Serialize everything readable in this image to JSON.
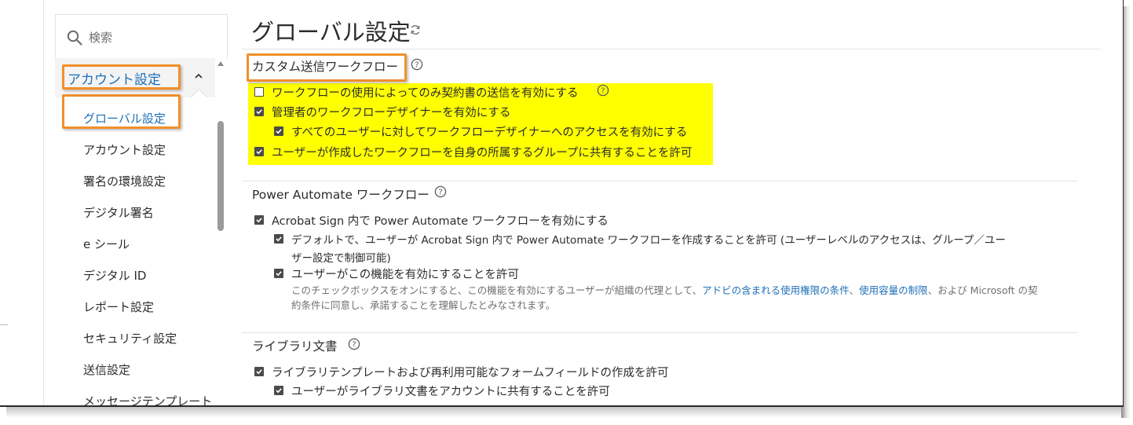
{
  "search": {
    "placeholder": "検索"
  },
  "nav": {
    "group_label": "アカウント設定",
    "items": [
      "グローバル設定",
      "アカウント設定",
      "署名の環境設定",
      "デジタル署名",
      "e シール",
      "デジタル ID",
      "レポート設定",
      "セキュリティ設定",
      "送信設定",
      "メッセージテンプレート"
    ],
    "active_index": 0
  },
  "page": {
    "title": "グローバル設定"
  },
  "sections": {
    "custom_workflow": {
      "title": "カスタム送信ワークフロー",
      "options": [
        {
          "label": "ワークフローの使用によってのみ契約書の送信を有効にする",
          "checked": false
        },
        {
          "label": "管理者のワークフローデザイナーを有効にする",
          "checked": true
        },
        {
          "label": "すべてのユーザーに対してワークフローデザイナーへのアクセスを有効にする",
          "checked": true
        },
        {
          "label": "ユーザーが作成したワークフローを自身の所属するグループに共有することを許可",
          "checked": true
        }
      ]
    },
    "power_automate": {
      "title": "Power Automate ワークフロー",
      "options": [
        {
          "label": "Acrobat Sign 内で Power Automate ワークフローを有効にする",
          "checked": true
        },
        {
          "label_line1": "デフォルトで、ユーザーが Acrobat Sign 内で Power Automate ワークフローを作成することを許可 (ユーザーレベルのアクセスは、グループ／ユー",
          "label_line2": "ザー設定で制御可能)",
          "checked": true
        },
        {
          "label": "ユーザーがこの機能を有効にすることを許可",
          "checked": true
        }
      ],
      "description": {
        "part1": "このチェックボックスをオンにすると、この機能を有効にするユーザーが組織の代理として、",
        "link1": "アドビの含まれる使用権限の条件",
        "sep": "、",
        "link2": "使用容量の制限",
        "part2": "、および Microsoft の契",
        "line2": "約条件に同意し、承諾することを理解したとみなされます。"
      }
    },
    "library": {
      "title": "ライブラリ文書",
      "options": [
        {
          "label": "ライブラリテンプレートおよび再利用可能なフォームフィールドの作成を許可",
          "checked": true
        },
        {
          "label": "ユーザーがライブラリ文書をアカウントに共有することを許可",
          "checked": true
        }
      ]
    }
  },
  "colors": {
    "accent_blue": "#1d6fb8",
    "highlight_orange": "#f0902a",
    "highlight_yellow": "#ffff00",
    "nav_bg": "#f4f4f4"
  }
}
